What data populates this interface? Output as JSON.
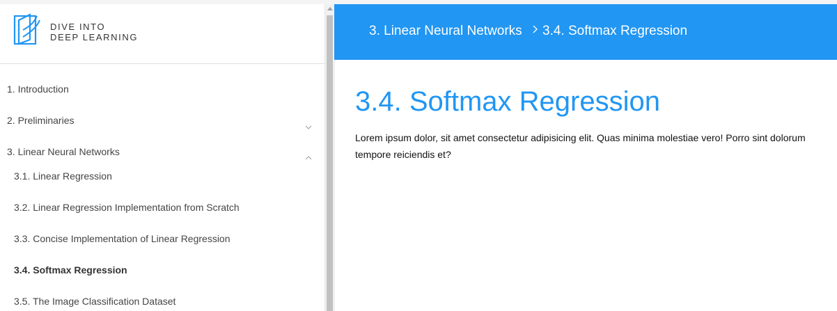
{
  "brand": {
    "line1": "DIVE INTO",
    "line2": "DEEP LEARNING",
    "logo_icon": "book-logo-icon",
    "color": "#2196f3"
  },
  "sidebar": {
    "items": [
      {
        "label": "1. Introduction"
      },
      {
        "label": "2. Preliminaries",
        "chevron": "chevron-down-icon"
      },
      {
        "label": "3. Linear Neural Networks",
        "chevron": "chevron-up-icon"
      },
      {
        "label": "3.1. Linear Regression"
      },
      {
        "label": "3.2. Linear Regression Implementation from Scratch"
      },
      {
        "label": "3.3. Concise Implementation of Linear Regression"
      },
      {
        "label": "3.4. Softmax Regression",
        "active": true
      },
      {
        "label": "3.5. The Image Classification Dataset"
      }
    ]
  },
  "header": {
    "crumb_parent": "3. Linear Neural Networks",
    "separator_icon": "chevron-right-icon",
    "crumb_current": "3.4. Softmax Regression",
    "background": "#2196f3"
  },
  "main": {
    "title": "3.4. Softmax Regression",
    "body_line1": "Lorem ipsum dolor, sit amet consectetur adipisicing elit. Quas minima molestiae vero! Porro sint dolorum",
    "body_line2": "tempore reiciendis et?"
  }
}
